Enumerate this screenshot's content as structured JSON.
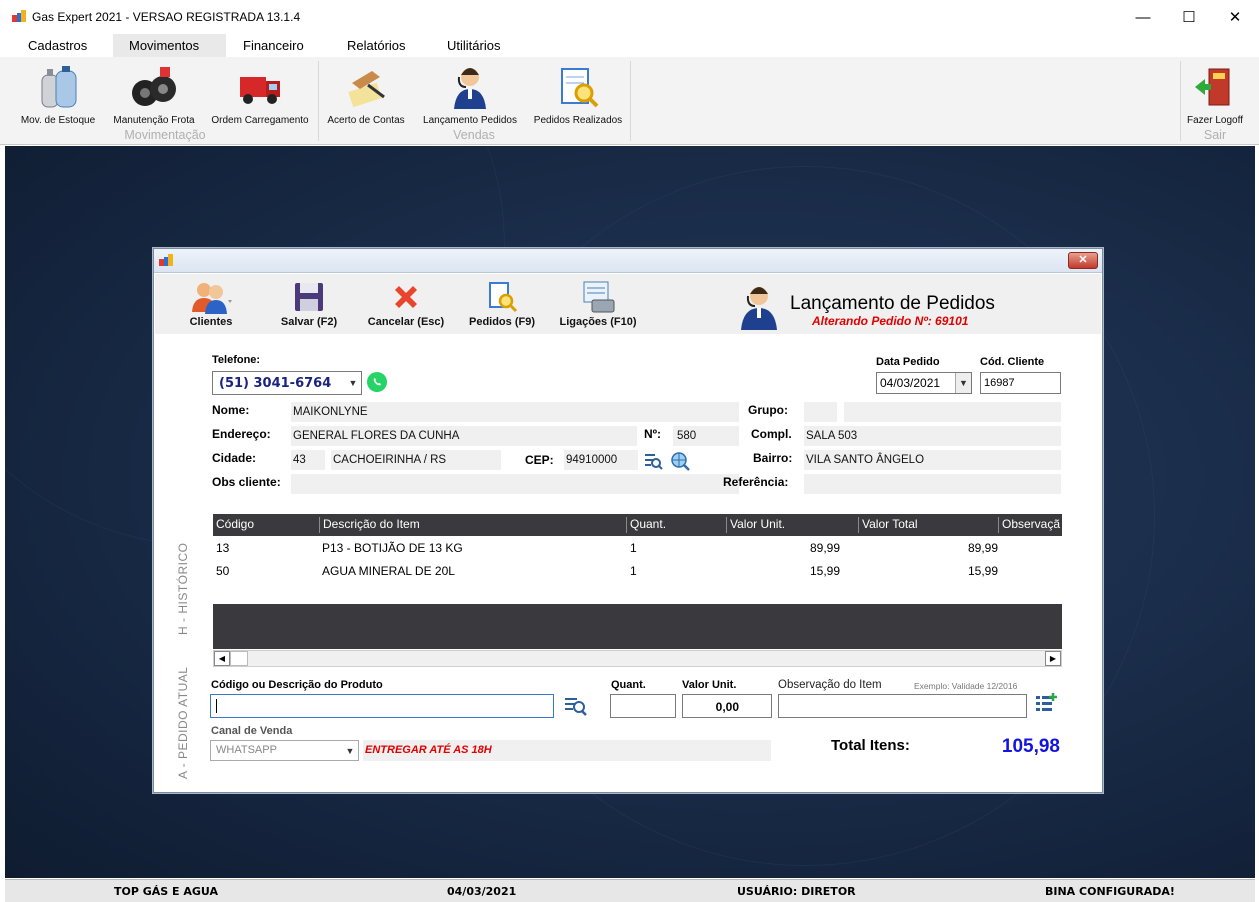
{
  "window": {
    "title": "Gas Expert 2021 - VERSAO REGISTRADA 13.1.4",
    "minimize": "—",
    "maximize": "☐",
    "close": "✕"
  },
  "menu": [
    "Cadastros",
    "Movimentos",
    "Financeiro",
    "Relatórios",
    "Utilitários"
  ],
  "ribbon": {
    "groups": [
      {
        "label": "Movimentação",
        "buttons": [
          "Mov. de Estoque",
          "Manutenção Frota",
          "Ordem Carregamento"
        ]
      },
      {
        "label": "Vendas",
        "buttons": [
          "Acerto de Contas",
          "Lançamento Pedidos",
          "Pedidos Realizados"
        ]
      },
      {
        "label": "Sair",
        "buttons": [
          "Fazer Logoff"
        ]
      }
    ]
  },
  "dialog": {
    "close": "✕",
    "toolbar": [
      "Clientes",
      "Salvar (F2)",
      "Cancelar (Esc)",
      "Pedidos (F9)",
      "Ligações (F10)"
    ],
    "title": "Lançamento de Pedidos",
    "subtitle": "Alterando Pedido Nº:  69101",
    "telefone_label": "Telefone:",
    "telefone": "(51) 3041-6764",
    "data_pedido_label": "Data Pedido",
    "data_pedido": "04/03/2021",
    "cod_cliente_label": "Cód. Cliente",
    "cod_cliente": "16987",
    "nome_label": "Nome:",
    "nome": "MAIKONLYNE",
    "grupo_label": "Grupo:",
    "grupo_code": "",
    "grupo_name": "",
    "endereco_label": "Endereço:",
    "endereco": "GENERAL FLORES DA CUNHA",
    "numero_label": "Nº:",
    "numero": "580",
    "compl_label": "Compl.",
    "compl": "SALA 503",
    "cidade_label": "Cidade:",
    "cidade_code": "43",
    "cidade": "CACHOEIRINHA / RS",
    "cep_label": "CEP:",
    "cep": "94910000",
    "bairro_label": "Bairro:",
    "bairro": "VILA SANTO ÂNGELO",
    "obs_label": "Obs cliente:",
    "obs": "",
    "referencia_label": "Referência:",
    "referencia": "",
    "grid": {
      "columns": [
        "Código",
        "Descrição do Item",
        "Quant.",
        "Valor Unit.",
        "Valor Total",
        "Observaçã"
      ],
      "rows": [
        {
          "codigo": "13",
          "descricao": "P13 - BOTIJÃO DE 13 KG",
          "quant": "1",
          "valor_unit": "89,99",
          "valor_total": "89,99"
        },
        {
          "codigo": "50",
          "descricao": "AGUA MINERAL DE 20L",
          "quant": "1",
          "valor_unit": "15,99",
          "valor_total": "15,99"
        }
      ]
    },
    "side_historico": "H - HISTÓRICO",
    "side_atual": "A - PEDIDO ATUAL",
    "produto_label": "Código ou Descrição do Produto",
    "produto_value": "",
    "quant_label": "Quant.",
    "quant_value": "",
    "valor_unit_label": "Valor Unit.",
    "valor_unit_value": "0,00",
    "obs_item_label": "Observação do Item",
    "obs_item_hint": "Exemplo: Validade 12/2016",
    "obs_item_value": "",
    "canal_label": "Canal de Venda",
    "canal": "WHATSAPP",
    "entrega": "ENTREGAR ATÉ AS 18H",
    "total_label": "Total Itens:",
    "total": "105,98"
  },
  "status": {
    "empresa": "TOP GÁS E AGUA",
    "data": "04/03/2021",
    "usuario": "USUÁRIO: DIRETOR",
    "bina": "BINA CONFIGURADA!"
  }
}
